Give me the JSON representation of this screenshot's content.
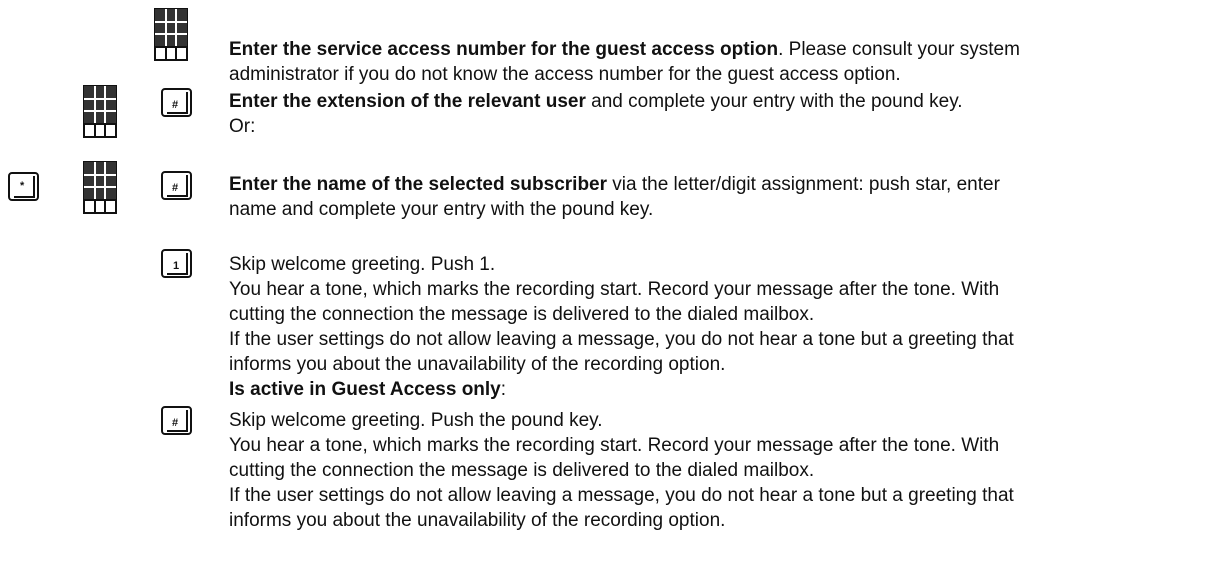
{
  "colors": {
    "text": "#111111",
    "keypad_dark": "#333333",
    "key_border": "#222222"
  },
  "steps": [
    {
      "icons": [
        "keypad-icon"
      ],
      "bold": "Enter the service access number for the guest access option",
      "lines": [
        ". Please consult your system",
        "administrator if you do not know the access number for the guest access option."
      ]
    },
    {
      "icons": [
        "keypad-icon",
        "pound-key-icon"
      ],
      "bold": "Enter the extension of the relevant user",
      "lines": [
        " and complete your entry with the pound key.",
        "Or:"
      ]
    },
    {
      "icons": [
        "star-key-icon",
        "keypad-icon",
        "pound-key-icon"
      ],
      "bold": "Enter the name of the selected subscriber",
      "lines": [
        " via the letter/digit assignment: push star, enter",
        "name and complete your entry with the pound key."
      ]
    },
    {
      "icons": [
        "one-key-icon"
      ],
      "lines": [
        "Skip welcome greeting. Push 1.",
        "You hear a tone, which marks the recording start. Record your message after the tone. With",
        "cutting the connection the message is delivered to the dialed mailbox.",
        "If the user settings do not allow leaving a message, you do not hear a tone but a greeting that",
        "informs you about the unavailability of the recording option."
      ],
      "bold_note": "Is active in Guest Access only",
      "bold_note_suffix": ":"
    },
    {
      "icons": [
        "pound-key-icon"
      ],
      "lines": [
        "Skip welcome greeting. Push the pound key.",
        "You hear a tone, which marks the recording start. Record your message after the tone. With",
        "cutting the connection the message is delivered to the dialed mailbox.",
        "If the user settings do not allow leaving a message, you do not hear a tone but a greeting that",
        "informs you about the unavailability of the recording option."
      ]
    }
  ],
  "keys": {
    "pound": "#",
    "star": "*",
    "one": "1"
  }
}
